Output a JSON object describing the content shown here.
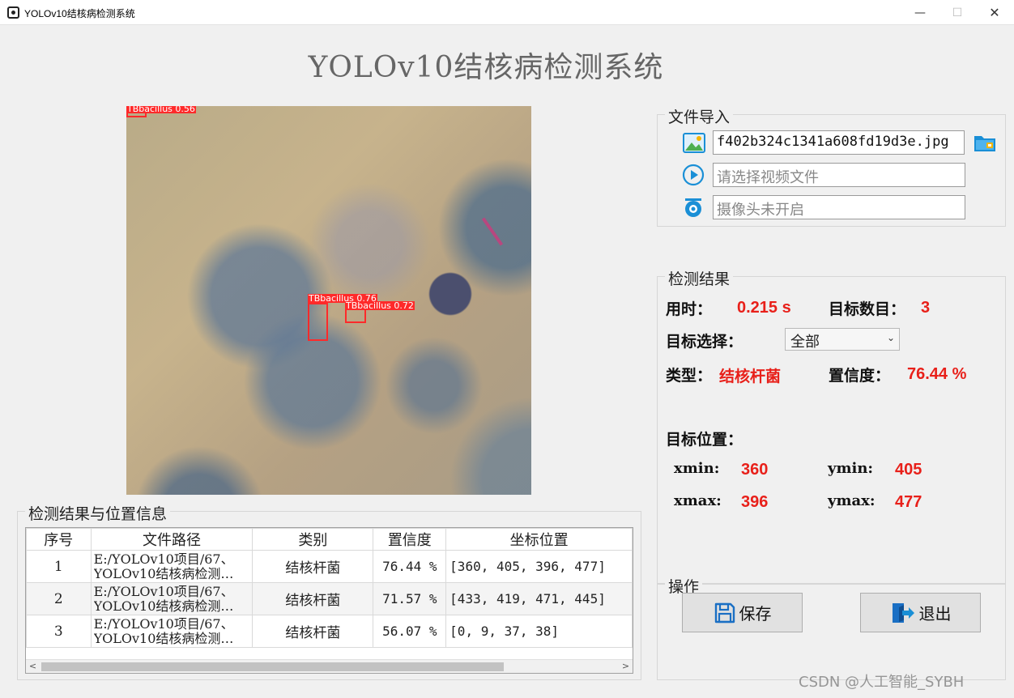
{
  "window": {
    "title": "YOLOv10结核病检测系统",
    "min": "—",
    "max": "☐",
    "close": "✕"
  },
  "page_title": "YOLOv10结核病检测系统",
  "image_view": {
    "detections": [
      {
        "label": "TBbacillus 0.56"
      },
      {
        "label": "TBbacillus 0.76"
      },
      {
        "label": "TBbacillus 0.72"
      }
    ]
  },
  "file_import": {
    "title": "文件导入",
    "image_path": "f402b324c1341a608fd19d3e.jpg",
    "video_placeholder": "请选择视频文件",
    "camera_placeholder": "摄像头未开启",
    "icons": {
      "image": "image-file-icon",
      "folder": "open-folder-icon",
      "video": "play-video-icon",
      "camera": "camera-icon"
    }
  },
  "results": {
    "title": "检测结果",
    "time_label": "用时：",
    "time_value": "0.215 s",
    "count_label": "目标数目：",
    "count_value": "3",
    "select_label": "目标选择：",
    "select_value": "全部",
    "type_label": "类型：",
    "type_value": "结核杆菌",
    "conf_label": "置信度：",
    "conf_value": "76.44 %",
    "pos_label": "目标位置：",
    "xmin_label": "xmin:",
    "xmin_value": "360",
    "ymin_label": "ymin:",
    "ymin_value": "405",
    "xmax_label": "xmax:",
    "xmax_value": "396",
    "ymax_label": "ymax:",
    "ymax_value": "477"
  },
  "operations": {
    "title": "操作",
    "save_label": "保存",
    "exit_label": "退出"
  },
  "table": {
    "title": "检测结果与位置信息",
    "headers": [
      "序号",
      "文件路径",
      "类别",
      "置信度",
      "坐标位置"
    ],
    "rows": [
      {
        "index": "1",
        "path1": "E:/YOLOv10项目/67、",
        "path2": "YOLOv10结核病检测…",
        "cls": "结核杆菌",
        "conf": "76.44 %",
        "coords": "[360, 405, 396, 477]"
      },
      {
        "index": "2",
        "path1": "E:/YOLOv10项目/67、",
        "path2": "YOLOv10结核病检测…",
        "cls": "结核杆菌",
        "conf": "71.57 %",
        "coords": "[433, 419, 471, 445]"
      },
      {
        "index": "3",
        "path1": "E:/YOLOv10项目/67、",
        "path2": "YOLOv10结核病检测…",
        "cls": "结核杆菌",
        "conf": "56.07 %",
        "coords": "[0, 9, 37, 38]"
      }
    ],
    "scroll_left": "<",
    "scroll_right": ">"
  },
  "watermark": "CSDN @人工智能_SYBH",
  "colors": {
    "accent": "#e8201a",
    "bbox": "#ff2a2a",
    "icon_blue": "#1a8fd6"
  }
}
